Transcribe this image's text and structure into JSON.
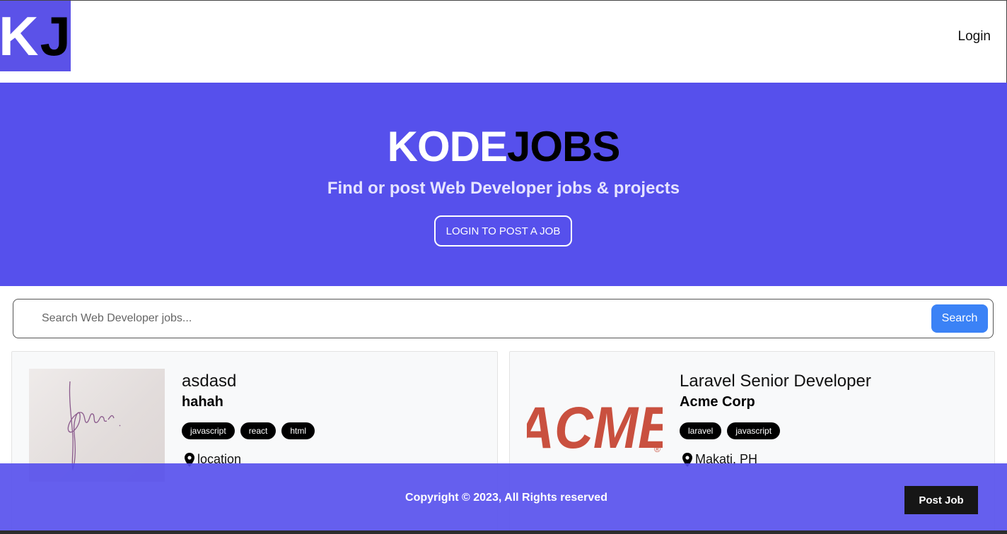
{
  "nav": {
    "logo_k": "K",
    "logo_j": "J",
    "login_label": "Login"
  },
  "hero": {
    "title_white": "KODE",
    "title_black": "JOBS",
    "subtitle": "Find or post Web Developer jobs & projects",
    "cta_label": "LOGIN TO POST A JOB"
  },
  "search": {
    "placeholder": "Search Web Developer jobs...",
    "button_label": "Search"
  },
  "jobs": [
    {
      "title": "asdasd",
      "company": "hahah",
      "tags": [
        "javascript",
        "react",
        "html"
      ],
      "location": "location"
    },
    {
      "title": "Laravel Senior Developer",
      "company": "Acme Corp",
      "tags": [
        "laravel",
        "javascript"
      ],
      "location": "Makati, PH",
      "logo_text": "ACME",
      "logo_mark": "®"
    }
  ],
  "footer": {
    "copyright": "Copyright © 2023, All Rights reserved",
    "post_job_label": "Post Job"
  },
  "colors": {
    "brand": "#5650ec",
    "search_button": "#3b82f6",
    "acme_red": "#c9503f"
  },
  "icons": [
    "search-icon",
    "map-pin-icon"
  ]
}
